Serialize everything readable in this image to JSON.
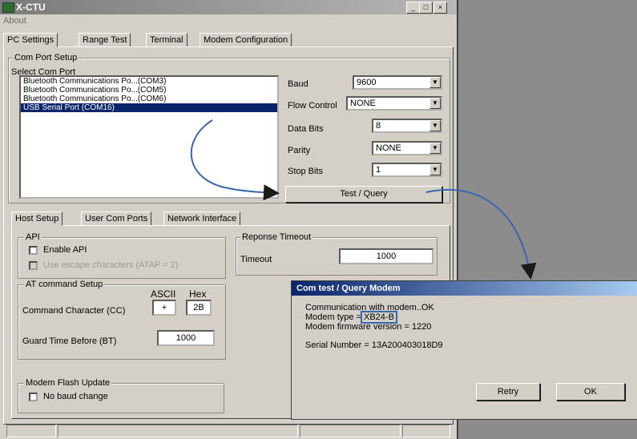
{
  "window": {
    "title": "X-CTU",
    "menu": [
      "About"
    ],
    "controls": [
      "_",
      "□",
      "×"
    ]
  },
  "tabs": [
    "PC Settings",
    "Range Test",
    "Terminal",
    "Modem Configuration"
  ],
  "com_port": {
    "group_label": "Com Port Setup",
    "select_label": "Select Com Port",
    "ports": [
      "Bluetooth Communications Po...(COM3)",
      "Bluetooth Communications Po...(COM5)",
      "Bluetooth Communications Po...(COM6)",
      "USB Serial Port (COM16)"
    ],
    "selected_index": 3,
    "baud_label": "Baud",
    "baud_value": "9600",
    "flow_label": "Flow Control",
    "flow_value": "NONE",
    "databits_label": "Data Bits",
    "databits_value": "8",
    "parity_label": "Parity",
    "parity_value": "NONE",
    "stopbits_label": "Stop Bits",
    "stopbits_value": "1",
    "test_button": "Test / Query"
  },
  "subtabs": [
    "Host Setup",
    "User Com Ports",
    "Network Interface"
  ],
  "api": {
    "group_label": "API",
    "enable_label": "Enable API",
    "escape_label": "Use escape characters (ATAP = 2)"
  },
  "timeout": {
    "group_label": "Reponse Timeout",
    "label": "Timeout",
    "value": "1000"
  },
  "at_setup": {
    "group_label": "AT command Setup",
    "ascii_header": "ASCII",
    "hex_header": "Hex",
    "cc_label": "Command Character (CC)",
    "cc_ascii": "+",
    "cc_hex": "2B",
    "bt_label": "Guard Time Before (BT)",
    "bt_value": "1000"
  },
  "flash": {
    "group_label": "Modem Flash Update",
    "nobaud_label": "No baud change"
  },
  "dialog": {
    "title": "Com test / Query Modem",
    "line1": "Communication with modem..OK",
    "line2_prefix": "Modem type = ",
    "line2_value": "XB24-B",
    "line3": "Modem firmware version = 1220",
    "line4": "Serial Number = 13A200403018D9",
    "retry": "Retry",
    "ok": "OK"
  },
  "colors": {
    "arrow": "#3a66b0",
    "selection": "#0a246a",
    "window_bg": "#d4d0c8"
  }
}
